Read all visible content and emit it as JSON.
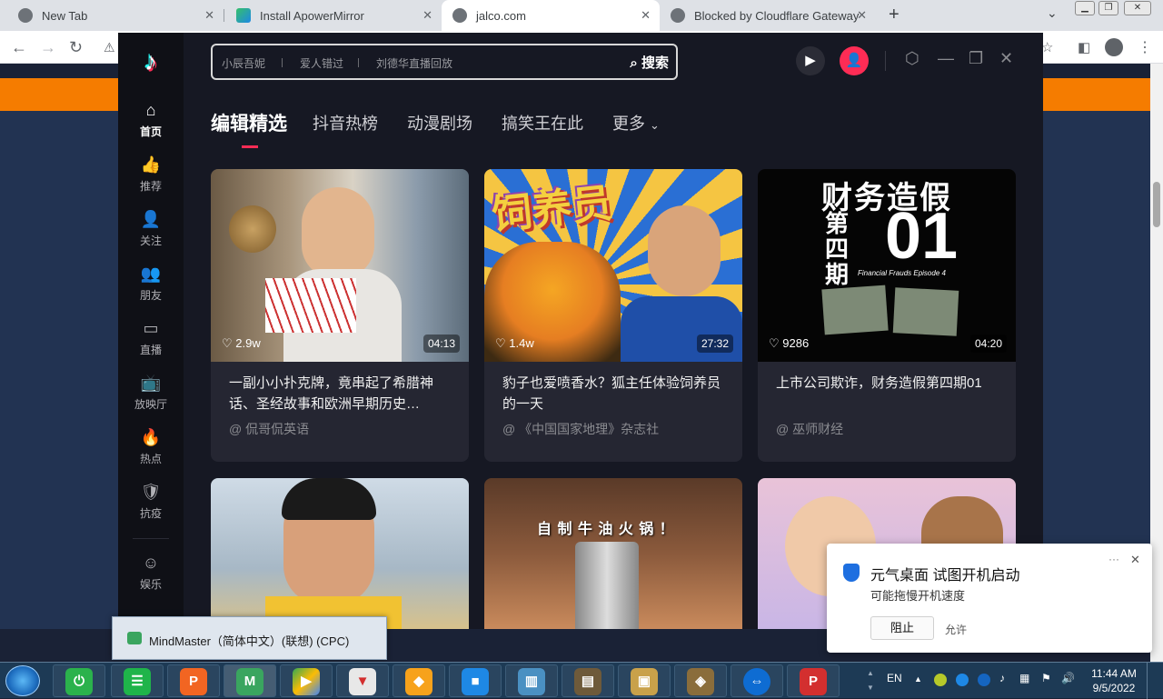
{
  "browser": {
    "tabs": [
      {
        "title": "New Tab",
        "active": false
      },
      {
        "title": "Install ApowerMirror",
        "active": false
      },
      {
        "title": "jalco.com",
        "active": true
      },
      {
        "title": "Blocked by Cloudflare Gateway",
        "active": false
      }
    ],
    "new_tab_glyph": "+",
    "tab_close_glyph": "✕"
  },
  "app": {
    "name": "抖音",
    "search": {
      "suggestions": [
        "小辰吾妮",
        "爱人错过",
        "刘德华直播回放"
      ],
      "button_label": "搜索"
    },
    "sidebar": [
      {
        "label": "首页",
        "icon": "home-icon",
        "glyph": "⌂",
        "active": true
      },
      {
        "label": "推荐",
        "icon": "thumb-up-icon",
        "glyph": "👍"
      },
      {
        "label": "关注",
        "icon": "follow-icon",
        "glyph": "👤"
      },
      {
        "label": "朋友",
        "icon": "friends-icon",
        "glyph": "👥"
      },
      {
        "label": "直播",
        "icon": "live-icon",
        "glyph": "▭"
      },
      {
        "label": "放映厅",
        "icon": "tv-icon",
        "glyph": "📺"
      },
      {
        "label": "热点",
        "icon": "fire-icon",
        "glyph": "🔥"
      },
      {
        "label": "抗疫",
        "icon": "shield-icon",
        "glyph": "🛡"
      },
      {
        "label": "娱乐",
        "icon": "smile-icon",
        "glyph": "☺"
      }
    ],
    "subtabs": [
      "编辑精选",
      "抖音热榜",
      "动漫剧场",
      "搞笑王在此",
      "更多"
    ],
    "more_chevron": "⌄",
    "videos": [
      {
        "likes": "2.9w",
        "duration": "04:13",
        "title": "一副小小扑克牌，竟串起了希腊神话、圣经故事和欧洲早期历史…",
        "author": "@ 侃哥侃英语"
      },
      {
        "likes": "1.4w",
        "duration": "27:32",
        "title": "豹子也爱喷香水？狐主任体验饲养员的一天",
        "author": "@ 《中国国家地理》杂志社",
        "thumb_text": "饲养员"
      },
      {
        "likes": "9286",
        "duration": "04:20",
        "title": "上市公司欺诈，财务造假第四期01",
        "author": "@ 巫师财经",
        "thumb_text": "财务造假",
        "thumb_side": "第四期",
        "thumb_num": "01",
        "thumb_sub": "Financial Frauds Episode 4"
      }
    ],
    "row2": [
      {
        "overlay": ""
      },
      {
        "overlay": "自 制 牛 油 火 锅 ！"
      },
      {
        "overlay": ""
      }
    ]
  },
  "notification": {
    "title": "元气桌面 试图开机启动",
    "body": "可能拖慢开机速度",
    "block_label": "阻止",
    "allow_label": "允许",
    "more_glyph": "···",
    "close_glyph": "✕"
  },
  "taskbar": {
    "popup_label": "MindMaster（简体中文）(联想) (CPC)",
    "language": "EN",
    "time": "11:44 AM",
    "date": "9/5/2022"
  },
  "colors": {
    "accent": "#fe2c55",
    "app_bg": "#161823",
    "orange_banner": "#f57c00"
  }
}
